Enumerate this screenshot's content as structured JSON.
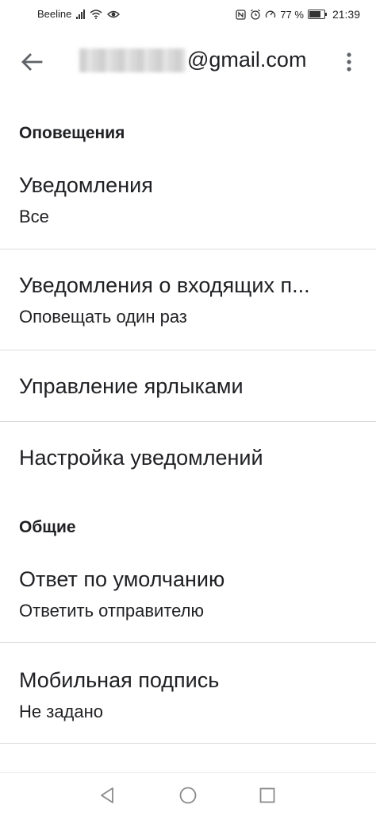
{
  "status_bar": {
    "carrier": "Beeline",
    "battery": "77 %",
    "battery_level": 0.77,
    "time": "21:39"
  },
  "toolbar": {
    "account_suffix": "@gmail.com",
    "back_icon": "arrow-back-icon",
    "more_icon": "more-vert-icon"
  },
  "sections": {
    "notifications": "Оповещения",
    "general": "Общие"
  },
  "items": [
    {
      "title": "Уведомления",
      "subtitle": "Все"
    },
    {
      "title": "Уведомления о входящих п...",
      "subtitle": "Оповещать один раз"
    },
    {
      "title": "Управление ярлыками"
    },
    {
      "title": "Настройка уведомлений"
    },
    {
      "title": "Ответ по умолчанию",
      "subtitle": "Ответить отправителю"
    },
    {
      "title": "Мобильная подпись",
      "subtitle": "Не задано"
    }
  ],
  "nav": {
    "back": "nav-back-icon",
    "home": "nav-home-icon",
    "recents": "nav-recents-icon"
  },
  "colors": {
    "text": "#202124",
    "divider": "#dadce0",
    "icon": "#5f6368"
  }
}
